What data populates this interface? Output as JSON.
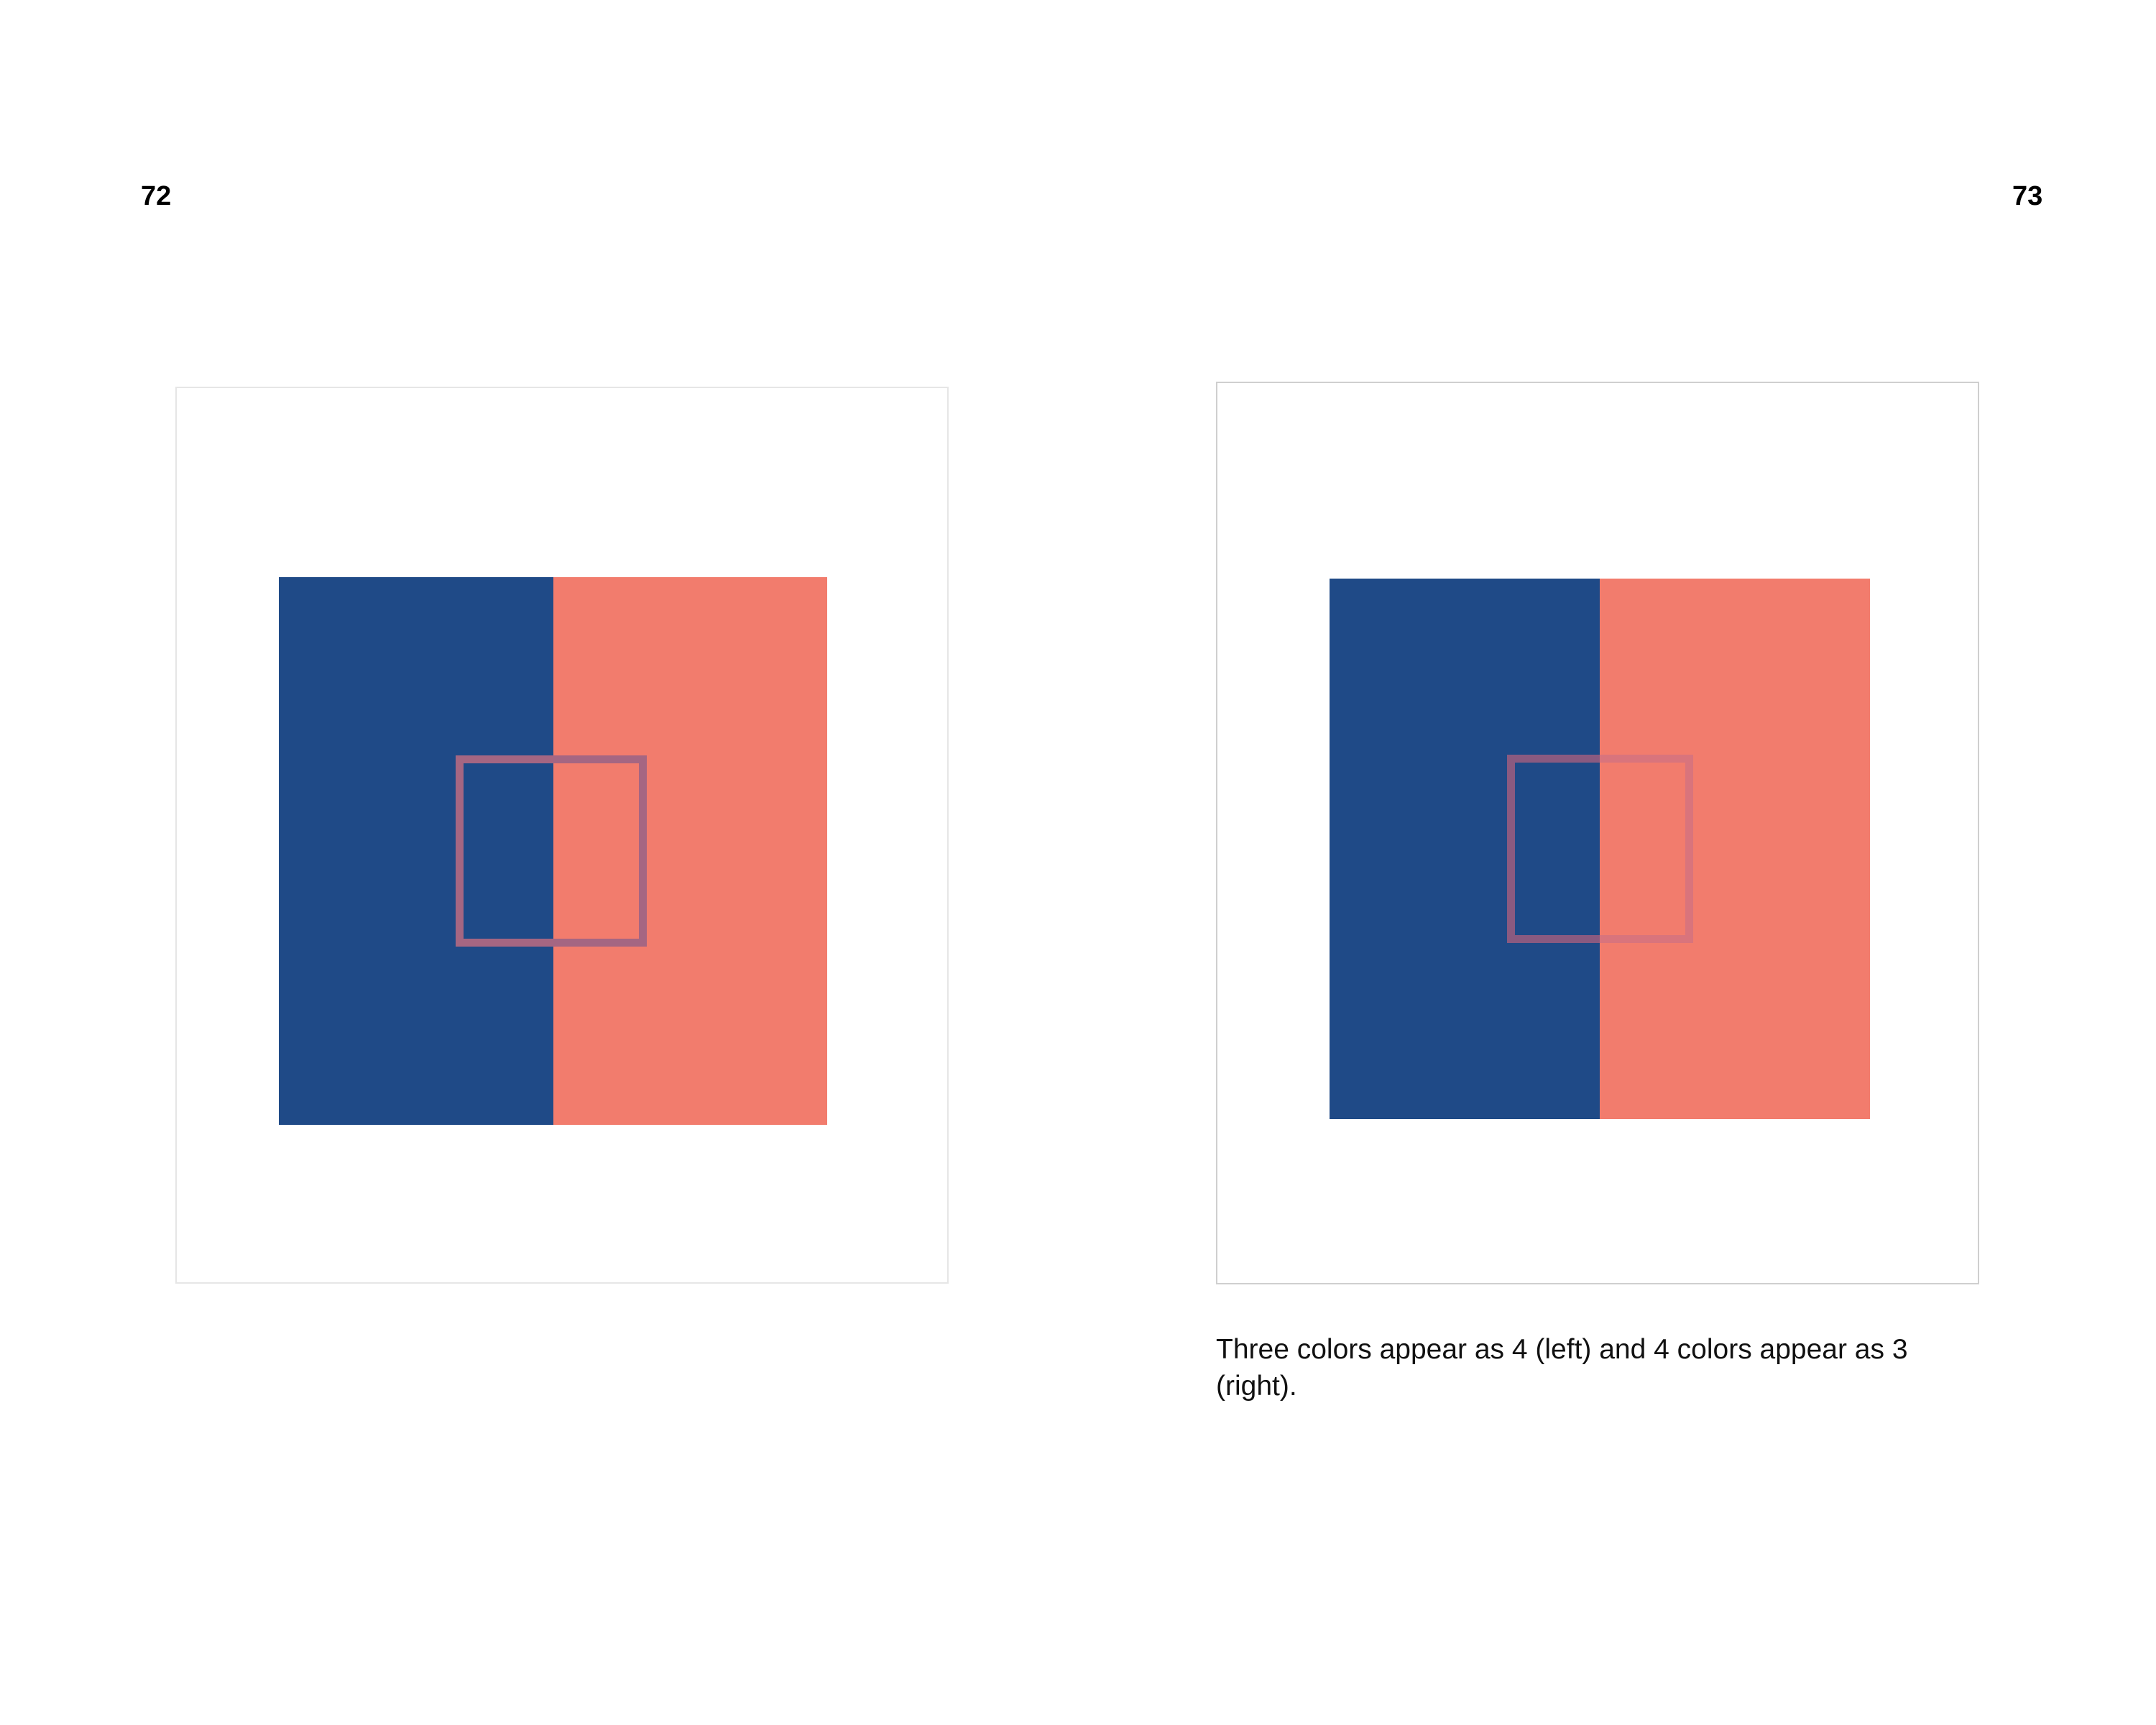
{
  "pages": {
    "left_number": "72",
    "right_number": "73"
  },
  "figures": {
    "left": {
      "blue": "#1f4a87",
      "coral": "#f27c6d",
      "square_color": "#a56682"
    },
    "right": {
      "blue": "#1f4a87",
      "coral": "#f27c6d",
      "square_left_color": "#8a5a80",
      "square_right_color": "#d9747c"
    }
  },
  "caption": "Three colors appear as 4 (left) and 4 colors appear as 3 (right)."
}
